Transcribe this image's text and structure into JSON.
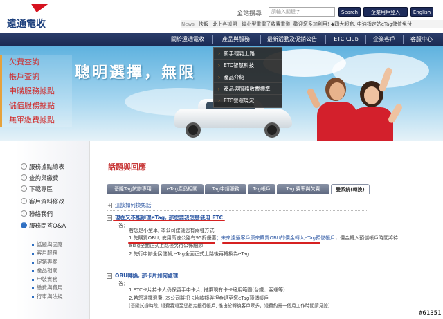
{
  "header": {
    "logo_text": "遠通電收",
    "search_label": "全站搜尋",
    "search_placeholder": "請輸入關鍵字",
    "search_button": "Search",
    "corp_login_button": "企業用戶登入",
    "english_button": "English",
    "news_label": "News",
    "news_quicklink": "快報",
    "news_text": "北上各據開一縱小型重電子收費重道, 歡迎您多加利用!  ◆四大超商, 中油指定站eTag儲值免付"
  },
  "nav": {
    "items": [
      {
        "label": "關於遠通電收"
      },
      {
        "label": "產品與服務"
      },
      {
        "label": "最新活動及促銷公告"
      },
      {
        "label": "ETC Club"
      },
      {
        "label": "企業客戶"
      },
      {
        "label": "客服中心"
      }
    ]
  },
  "dropdown": {
    "items": [
      {
        "label": "新手輕鬆上路"
      },
      {
        "label": "ETC智慧科技"
      },
      {
        "label": "產品介紹"
      },
      {
        "label": "產品與服務收費標準"
      },
      {
        "label": "ETC營運現況"
      }
    ]
  },
  "hero": {
    "title": "聰明選擇，無限",
    "quick_links": [
      {
        "label": "欠費查詢"
      },
      {
        "label": "帳戶查詢"
      },
      {
        "label": "申購服務據點"
      },
      {
        "label": "儲值服務據點"
      },
      {
        "label": "無軍繳費據點"
      }
    ]
  },
  "sidebar": {
    "items": [
      {
        "label": "服務據點總表",
        "icon": "chevron-left-icon"
      },
      {
        "label": "查詢與繳費",
        "icon": "chevron-left-icon"
      },
      {
        "label": "下載專區",
        "icon": "chevron-left-icon"
      },
      {
        "label": "客戶資料修改",
        "icon": "chevron-left-icon"
      },
      {
        "label": "聯絡我們",
        "icon": "chevron-left-icon"
      },
      {
        "label": "服務問答Q&A",
        "icon": "chevron-down-icon"
      }
    ],
    "sub_items": [
      {
        "label": "話題與回應"
      },
      {
        "label": "客戶服務"
      },
      {
        "label": "促銷專案"
      },
      {
        "label": "產品相關"
      },
      {
        "label": "申裝實務"
      },
      {
        "label": "繳費與費用"
      },
      {
        "label": "行車與法規"
      }
    ]
  },
  "main": {
    "title": "話題與回應",
    "tabs": [
      {
        "label": "基隆Tag試辦專用"
      },
      {
        "label": "eTag產品相關"
      },
      {
        "label": "Tag申請服務"
      },
      {
        "label": "Tag帳戶"
      },
      {
        "label": "Tag 費率與欠費"
      },
      {
        "label": "雙系統(轉換)"
      }
    ],
    "q1_title": "這該如何換免話",
    "q2_title": "現在又不能辦理eTag, 那您要我怎麼使用 ETC",
    "q2_answer_label": "答：",
    "q2_answer_lines": [
      "若您是小型車, 本公司建議您有兩種方式",
      "1.先購買OBU, 使用高速公路有95折優惠",
      "；未來遠通客戶原來購買OBU的價金轉入eTag預儲帳戶",
      "，價金轉入預儲帳戶時間將待",
      "eTag全面正式上路後另行公佈細節",
      "2.先行申辦全民儲帳,eTag全面正式上路後再轉換為eTag."
    ],
    "q3_title": "OBU轉換, 那卡片如何處理",
    "q3_answer_label": "答：",
    "q3_answer_lines": [
      "1.ETC卡片持卡人仍保留手中卡片, 搭乘現有卡卡適用範圍(台鐵、客運等)",
      "2.若您選擇退費, 本公司將把卡片款額與押金退至您eTag預儲帳戶",
      "(基隆試辦時段, 退費將退至您指定銀行帳戶, 惟由於轉換客戶眾多，退費約需一個月工作時間請見諒)"
    ]
  },
  "badge": "#61351"
}
